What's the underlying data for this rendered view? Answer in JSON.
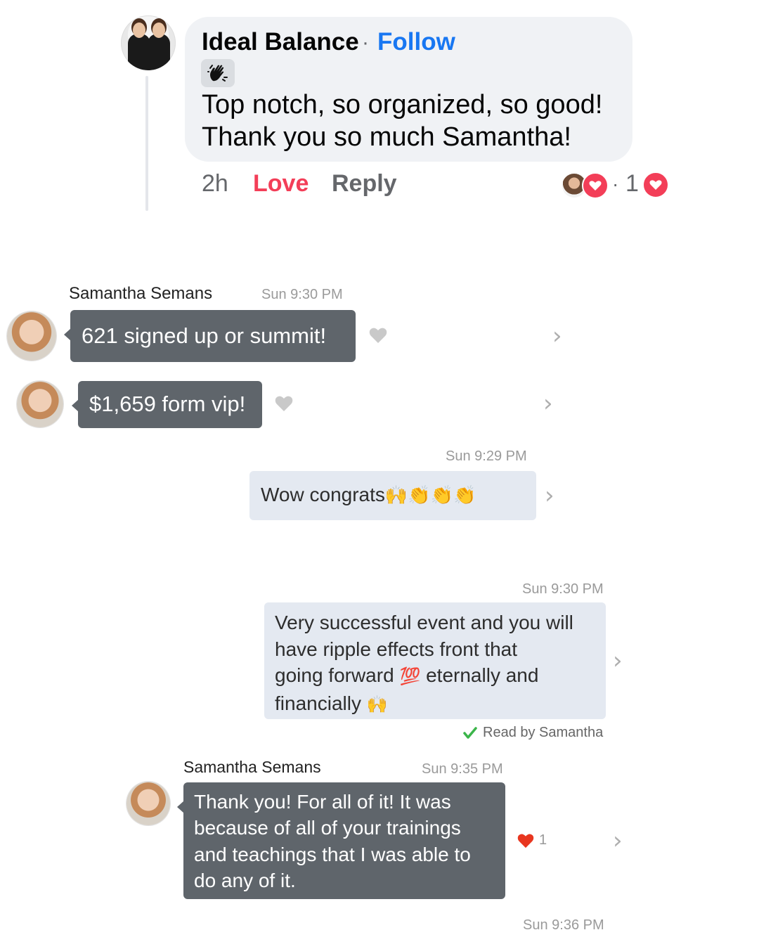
{
  "colors": {
    "fb_blue": "#1877f2",
    "fb_love": "#f33e58",
    "bubble_dark": "#5f656b",
    "bubble_light": "#e4e9f1",
    "read_check": "#3bb54a"
  },
  "comment": {
    "author": "Ideal Balance",
    "separator": "·",
    "follow_label": "Follow",
    "badge_icon": "waving-hand-icon",
    "text_lines": [
      "Top notch, so organized, so good!",
      "Thank you so much Samantha!"
    ],
    "time": "2h",
    "love_label": "Love",
    "reply_label": "Reply",
    "reaction_separator": "·",
    "reaction_count": "1"
  },
  "messages": [
    {
      "sender": "Samantha Semans",
      "timestamp": "Sun 9:30 PM",
      "text": "621 signed up or summit!"
    },
    {
      "text": "$1,659 form vip!"
    },
    {
      "timestamp": "Sun 9:29 PM",
      "text": "Wow congrats",
      "emoji": "🙌👏👏👏"
    },
    {
      "timestamp": "Sun 9:30 PM",
      "lines": [
        "Very successful event and you will",
        "have ripple effects front that",
        "going forward",
        "eternally and",
        "financially"
      ],
      "emoji_100": "💯",
      "emoji_raise": "🙌",
      "read_receipt": "Read by Samantha"
    },
    {
      "sender": "Samantha Semans",
      "timestamp": "Sun 9:35 PM",
      "lines": [
        "Thank you! For all of it! It was",
        "because of all of your trainings",
        "and teachings that I was able to",
        "do any of it."
      ],
      "heart_count": "1"
    },
    {
      "timestamp": "Sun 9:36 PM"
    }
  ]
}
